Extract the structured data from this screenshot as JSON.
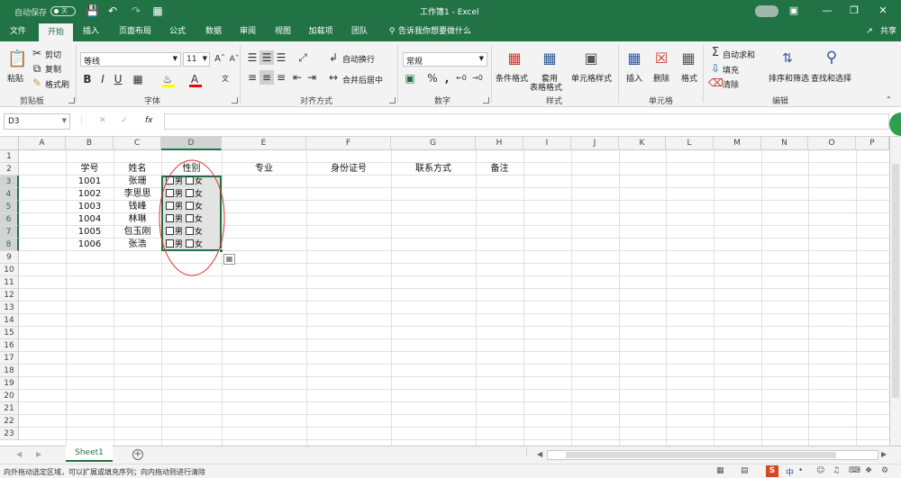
{
  "title_bar": {
    "autosave_label": "自动保存",
    "autosave_state": "关",
    "doc_title": "工作簿1 - Excel"
  },
  "tabs": [
    {
      "label": "文件"
    },
    {
      "label": "开始"
    },
    {
      "label": "插入"
    },
    {
      "label": "页面布局"
    },
    {
      "label": "公式"
    },
    {
      "label": "数据"
    },
    {
      "label": "审阅"
    },
    {
      "label": "视图"
    },
    {
      "label": "加载项"
    },
    {
      "label": "团队"
    }
  ],
  "tell_me": "告诉我你想要做什么",
  "share": "共享",
  "ribbon": {
    "clipboard": {
      "paste": "粘贴",
      "cut": "剪切",
      "copy": "复制",
      "format_painter": "格式刷",
      "group": "剪贴板"
    },
    "font": {
      "name": "等线",
      "size": "11",
      "bold": "B",
      "italic": "I",
      "underline": "U",
      "font_color": "A",
      "group": "字体"
    },
    "alignment": {
      "wrap": "自动换行",
      "merge": "合并后居中",
      "group": "对齐方式"
    },
    "number": {
      "format": "常规",
      "percent": "%",
      "comma": ",",
      "group": "数字"
    },
    "styles": {
      "conditional": "条件格式",
      "table_l1": "套用",
      "table_l2": "表格格式",
      "cell_style": "单元格样式",
      "group": "样式"
    },
    "cells": {
      "insert": "插入",
      "delete": "删除",
      "format": "格式",
      "group": "单元格"
    },
    "editing": {
      "autosum": "自动求和",
      "fill": "填充",
      "clear": "清除",
      "sort": "排序和筛选",
      "find": "查找和选择",
      "group": "编辑"
    }
  },
  "formula_bar": {
    "name_box": "D3",
    "fx": "fx",
    "formula": ""
  },
  "columns": [
    "A",
    "B",
    "C",
    "D",
    "E",
    "F",
    "G",
    "H",
    "I",
    "J",
    "K",
    "L",
    "M",
    "N",
    "O",
    "P"
  ],
  "rows": [
    "1",
    "2",
    "3",
    "4",
    "5",
    "6",
    "7",
    "8",
    "9",
    "10",
    "11",
    "12",
    "13",
    "14",
    "15",
    "16",
    "17",
    "18",
    "19",
    "20",
    "21",
    "22",
    "23"
  ],
  "headers": {
    "B": "学号",
    "C": "姓名",
    "D": "性别",
    "E": "专业",
    "F": "身份证号",
    "G": "联系方式",
    "H": "备注"
  },
  "students": [
    {
      "id": "1001",
      "name": "张珊",
      "male": "男",
      "female": "女"
    },
    {
      "id": "1002",
      "name": "李思思",
      "male": "男",
      "female": "女"
    },
    {
      "id": "1003",
      "name": "钱峰",
      "male": "男",
      "female": "女"
    },
    {
      "id": "1004",
      "name": "林琳",
      "male": "男",
      "female": "女"
    },
    {
      "id": "1005",
      "name": "包玉刚",
      "male": "男",
      "female": "女"
    },
    {
      "id": "1006",
      "name": "张浩",
      "male": "男",
      "female": "女"
    }
  ],
  "sheet_tab": "Sheet1",
  "status_text": "向外拖动选定区域，可以扩展或填充序列；向内拖动则进行清除",
  "accent": "#217346"
}
